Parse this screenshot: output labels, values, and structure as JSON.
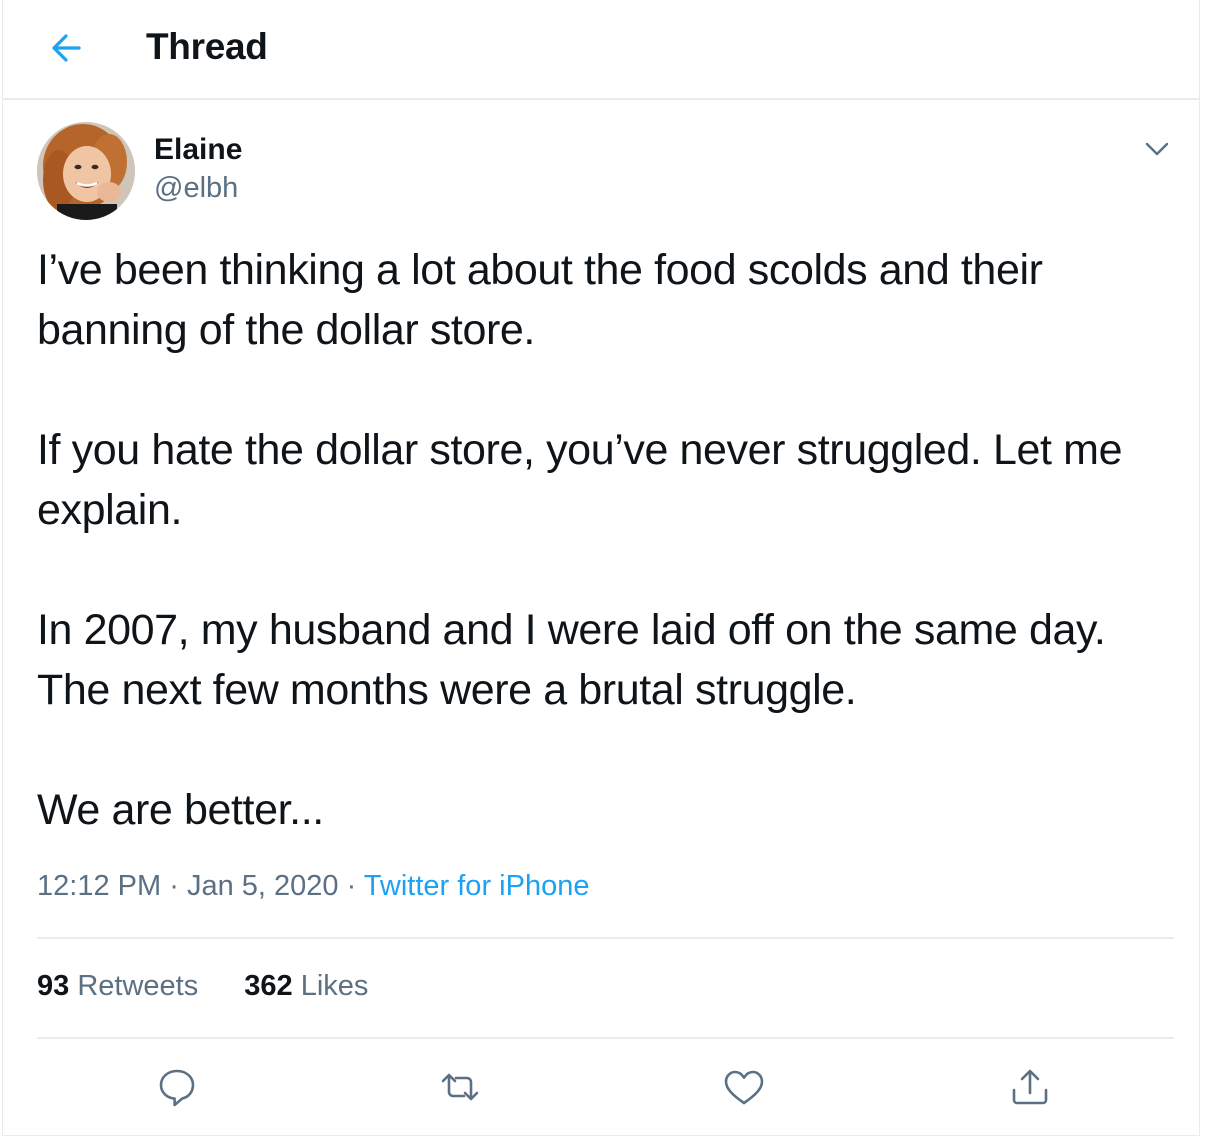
{
  "header": {
    "title": "Thread",
    "back_icon": "arrow-left-icon"
  },
  "author": {
    "display_name": "Elaine",
    "handle": "@elbh",
    "avatar": "avatar-photo"
  },
  "tweet": {
    "paragraphs": [
      "I’ve been thinking a lot about the food scolds and their banning of the dollar store.",
      "If you hate the dollar store, you’ve never struggled. Let me explain.",
      "In 2007, my husband and I were laid off on the same day. The next few months were a brutal struggle.",
      "We are better..."
    ],
    "time": "12:12 PM",
    "separator": "·",
    "date": "Jan 5, 2020",
    "source": "Twitter for iPhone"
  },
  "stats": {
    "retweets_count": "93",
    "retweets_label": "Retweets",
    "likes_count": "362",
    "likes_label": "Likes"
  },
  "actions": [
    "reply-icon",
    "retweet-icon",
    "like-icon",
    "share-icon"
  ],
  "colors": {
    "accent": "#1da1f2",
    "secondary_text": "#5b7083",
    "border": "#e6ecf0",
    "primary_text": "#0f1419"
  }
}
